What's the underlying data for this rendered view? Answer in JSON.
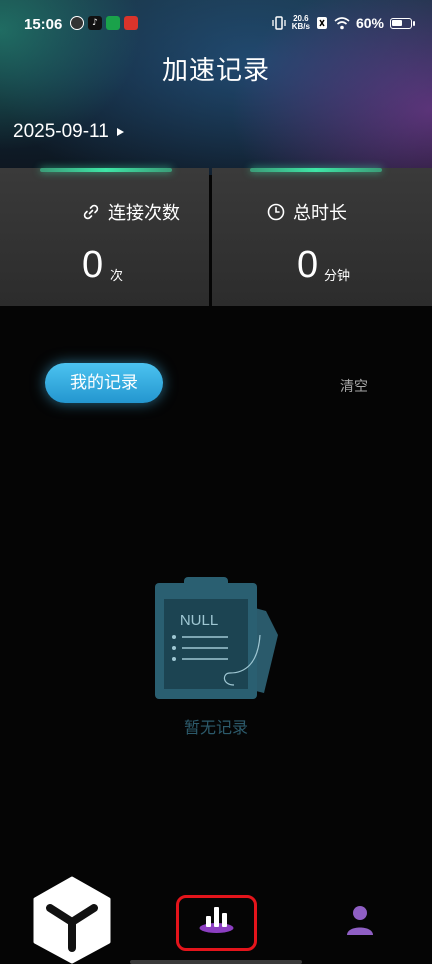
{
  "status": {
    "time": "15:06",
    "net_speed_value": "20.6",
    "net_speed_unit": "KB/s",
    "battery_percent": "60%",
    "battery_level": 0.6
  },
  "header": {
    "title": "加速记录",
    "date": "2025-09-11"
  },
  "stats": {
    "connections": {
      "label": "连接次数",
      "value": "0",
      "unit": "次"
    },
    "duration": {
      "label": "总时长",
      "value": "0",
      "unit": "分钟"
    }
  },
  "records": {
    "tab_label": "我的记录",
    "clear_label": "清空"
  },
  "empty": {
    "illustration_text": "NULL",
    "message": "暂无记录"
  },
  "colors": {
    "accent_green": "#3ee6a6",
    "accent_blue": "#2f9fd8",
    "highlight_red": "#e4141b",
    "nav_purple": "#9b45d6"
  }
}
